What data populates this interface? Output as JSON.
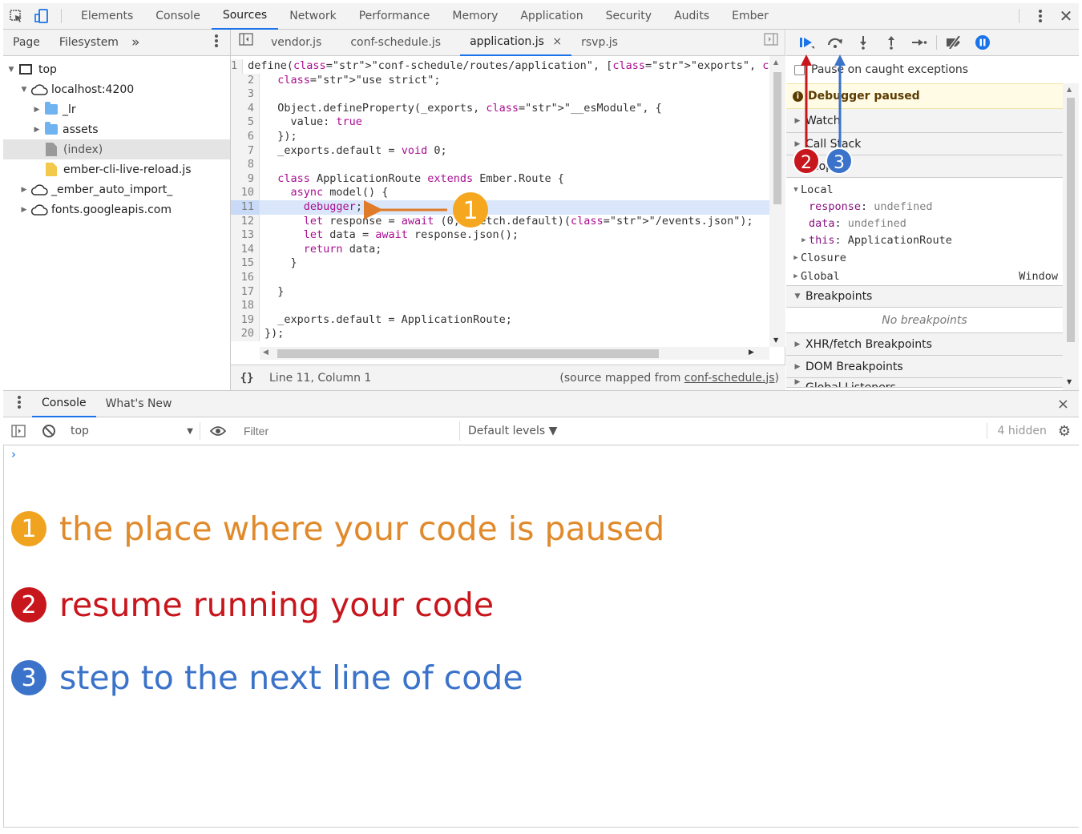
{
  "main_tabs": [
    "Elements",
    "Console",
    "Sources",
    "Network",
    "Performance",
    "Memory",
    "Application",
    "Security",
    "Audits",
    "Ember"
  ],
  "active_main_tab": "Sources",
  "navigator": {
    "tabs": [
      "Page",
      "Filesystem"
    ],
    "more": "»",
    "tree": {
      "top": "top",
      "host": "localhost:4200",
      "lr": "_lr",
      "assets": "assets",
      "index": "(index)",
      "livereload": "ember-cli-live-reload.js",
      "ember_auto_import": "_ember_auto_import_",
      "fonts": "fonts.googleapis.com"
    }
  },
  "editor": {
    "tabs": [
      "vendor.js",
      "conf-schedule.js",
      "application.js",
      "rsvp.js"
    ],
    "active_tab": "application.js",
    "close": "×",
    "lines": [
      {
        "n": "1",
        "t": "define(\"conf-schedule/routes/application\", [\"exports\", \"fetch\"], function (_"
      },
      {
        "n": "2",
        "t": "  \"use strict\";"
      },
      {
        "n": "3",
        "t": ""
      },
      {
        "n": "4",
        "t": "  Object.defineProperty(_exports, \"__esModule\", {"
      },
      {
        "n": "5",
        "t": "    value: true"
      },
      {
        "n": "6",
        "t": "  });"
      },
      {
        "n": "7",
        "t": "  _exports.default = void 0;"
      },
      {
        "n": "8",
        "t": ""
      },
      {
        "n": "9",
        "t": "  class ApplicationRoute extends Ember.Route {"
      },
      {
        "n": "10",
        "t": "    async model() {"
      },
      {
        "n": "11",
        "t": "      debugger;"
      },
      {
        "n": "12",
        "t": "      let response = await (0, _fetch.default)(\"/events.json\");"
      },
      {
        "n": "13",
        "t": "      let data = await response.json();"
      },
      {
        "n": "14",
        "t": "      return data;"
      },
      {
        "n": "15",
        "t": "    }"
      },
      {
        "n": "16",
        "t": ""
      },
      {
        "n": "17",
        "t": "  }"
      },
      {
        "n": "18",
        "t": ""
      },
      {
        "n": "19",
        "t": "  _exports.default = ApplicationRoute;"
      },
      {
        "n": "20",
        "t": "});"
      }
    ],
    "status_position": "Line 11, Column 1",
    "status_source_prefix": "(source mapped from ",
    "status_source_link": "conf-schedule.js",
    "status_source_suffix": ")"
  },
  "debugger": {
    "pause_caught": "Pause on caught exceptions",
    "paused_banner": "Debugger paused",
    "watch": "Watch",
    "call_stack": "Call Stack",
    "scope": "Scope",
    "local": "Local",
    "vars": [
      {
        "name": "response",
        "value": "undefined"
      },
      {
        "name": "data",
        "value": "undefined"
      }
    ],
    "this_name": "this",
    "this_value": "ApplicationRoute",
    "closure": "Closure",
    "global": "Global",
    "global_value": "Window",
    "breakpoints": "Breakpoints",
    "no_breakpoints": "No breakpoints",
    "xhr": "XHR/fetch Breakpoints",
    "dom": "DOM Breakpoints",
    "global_listeners": "Global Listeners"
  },
  "drawer": {
    "tabs": [
      "Console",
      "What's New"
    ],
    "close": "×",
    "context": "top",
    "filter_placeholder": "Filter",
    "levels": "Default levels ▼",
    "hidden": "4 hidden",
    "prompt": "›"
  },
  "annotations": [
    {
      "num": "1",
      "text": "the place where your code is paused",
      "color": "#f0a31e",
      "text_color": "#e08a2b"
    },
    {
      "num": "2",
      "text": "resume running your code",
      "color": "#c8161d",
      "text_color": "#c8161d"
    },
    {
      "num": "3",
      "text": "step to the next line of code",
      "color": "#3a73c9",
      "text_color": "#3a73c9"
    }
  ],
  "colors": {
    "accent": "#1a73e8",
    "paused_bg": "#fffbe5",
    "highlight": "#dae6f9"
  }
}
